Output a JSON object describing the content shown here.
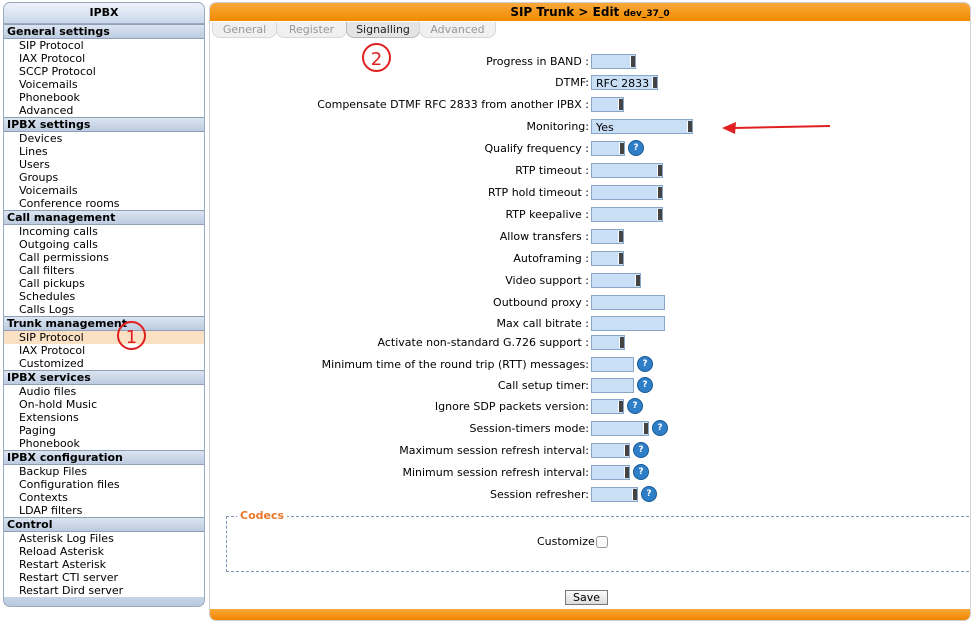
{
  "sidebar": {
    "title": "IPBX",
    "groups": [
      {
        "label": "General settings",
        "items": [
          "SIP Protocol",
          "IAX Protocol",
          "SCCP Protocol",
          "Voicemails",
          "Phonebook",
          "Advanced"
        ]
      },
      {
        "label": "IPBX settings",
        "items": [
          "Devices",
          "Lines",
          "Users",
          "Groups",
          "Voicemails",
          "Conference rooms"
        ]
      },
      {
        "label": "Call management",
        "items": [
          "Incoming calls",
          "Outgoing calls",
          "Call permissions",
          "Call filters",
          "Call pickups",
          "Schedules",
          "Calls Logs"
        ]
      },
      {
        "label": "Trunk management",
        "items": [
          "SIP Protocol",
          "IAX Protocol",
          "Customized"
        ]
      },
      {
        "label": "IPBX services",
        "items": [
          "Audio files",
          "On-hold Music",
          "Extensions",
          "Paging",
          "Phonebook"
        ]
      },
      {
        "label": "IPBX configuration",
        "items": [
          "Backup Files",
          "Configuration files",
          "Contexts",
          "LDAP filters"
        ]
      },
      {
        "label": "Control",
        "items": [
          "Asterisk Log Files",
          "Reload Asterisk",
          "Restart Asterisk",
          "Restart CTI server",
          "Restart Dird server"
        ]
      }
    ],
    "active": "Trunk management > SIP Protocol"
  },
  "main": {
    "title": "SIP Trunk > Edit",
    "subtitle": "dev_37_0",
    "tabs": [
      {
        "label": "General",
        "active": false
      },
      {
        "label": "Register",
        "active": false
      },
      {
        "label": "Signalling",
        "active": true
      },
      {
        "label": "Advanced",
        "active": false
      }
    ],
    "fields": [
      {
        "label": "Progress in BAND :",
        "type": "select",
        "value": ""
      },
      {
        "label": "DTMF:",
        "type": "select",
        "value": "RFC 2833"
      },
      {
        "label": "Compensate DTMF RFC 2833 from another IPBX :",
        "type": "select",
        "value": ""
      },
      {
        "label": "Monitoring:",
        "type": "select",
        "value": "Yes"
      },
      {
        "label": "Qualify frequency :",
        "type": "select",
        "value": "",
        "help": true
      },
      {
        "label": "RTP timeout :",
        "type": "select",
        "value": ""
      },
      {
        "label": "RTP hold timeout :",
        "type": "select",
        "value": ""
      },
      {
        "label": "RTP keepalive :",
        "type": "select",
        "value": ""
      },
      {
        "label": "Allow transfers :",
        "type": "select",
        "value": ""
      },
      {
        "label": "Autoframing :",
        "type": "select",
        "value": ""
      },
      {
        "label": "Video support :",
        "type": "select",
        "value": ""
      },
      {
        "label": "Outbound proxy :",
        "type": "text",
        "value": ""
      },
      {
        "label": "Max call bitrate :",
        "type": "text",
        "value": ""
      },
      {
        "label": "Activate non-standard G.726 support :",
        "type": "select",
        "value": ""
      },
      {
        "label": "Minimum time of the round trip (RTT) messages:",
        "type": "text",
        "value": "",
        "help": true
      },
      {
        "label": "Call setup timer:",
        "type": "text",
        "value": "",
        "help": true
      },
      {
        "label": "Ignore SDP packets version:",
        "type": "select",
        "value": "",
        "help": true
      },
      {
        "label": "Session-timers mode:",
        "type": "select",
        "value": "",
        "help": true
      },
      {
        "label": "Maximum session refresh interval:",
        "type": "select",
        "value": "",
        "help": true
      },
      {
        "label": "Minimum session refresh interval:",
        "type": "select",
        "value": "",
        "help": true
      },
      {
        "label": "Session refresher:",
        "type": "select",
        "value": "",
        "help": true
      }
    ],
    "codecs": {
      "legend": "Codecs",
      "customize_label": "Customize:",
      "customize_checked": false
    },
    "save_label": "Save"
  },
  "annotations": {
    "marker_1": "1",
    "marker_2": "2"
  },
  "colors": {
    "header_orange": "#f18a00",
    "field_blue": "#c9dff6",
    "active_item": "#fbe1c3",
    "annotation_red": "#e02020",
    "codecs_legend": "#e7782a"
  }
}
